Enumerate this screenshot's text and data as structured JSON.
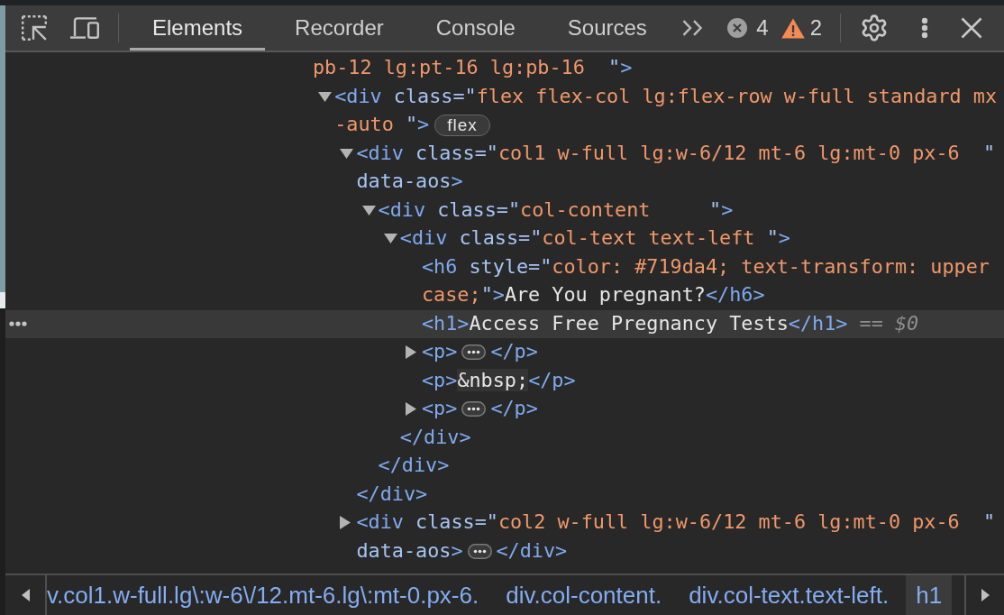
{
  "tabs": [
    {
      "label": "Elements",
      "selected": true
    },
    {
      "label": "Recorder",
      "selected": false
    },
    {
      "label": "Console",
      "selected": false
    },
    {
      "label": "Sources",
      "selected": false
    }
  ],
  "issue_counts": {
    "errors": "4",
    "warnings": "2"
  },
  "dom_tree": [
    {
      "selected": false,
      "lines": [
        [
          {
            "kind": "value",
            "text": "pb-12 lg:pt-16 lg:pb-16  "
          },
          {
            "kind": "attr",
            "text": "\""
          },
          {
            "kind": "tag",
            "text": ">"
          }
        ]
      ],
      "children": [
        {
          "expanded": true,
          "selected": false,
          "lines": [
            [
              {
                "kind": "tag",
                "text": "<div"
              },
              {
                "kind": "attr",
                "text": " class=\""
              },
              {
                "kind": "value",
                "text": "flex flex-col lg:flex-row w-full standard mx"
              }
            ],
            [
              {
                "kind": "value",
                "text": "-auto "
              },
              {
                "kind": "attr",
                "text": "\""
              },
              {
                "kind": "tag",
                "text": ">"
              },
              {
                "kind": "badge",
                "text": "flex"
              }
            ]
          ],
          "children": [
            {
              "expanded": true,
              "selected": false,
              "lines": [
                [
                  {
                    "kind": "tag",
                    "text": "<div"
                  },
                  {
                    "kind": "attr",
                    "text": " class=\""
                  },
                  {
                    "kind": "value",
                    "text": "col1 w-full lg:w-6/12 mt-6 lg:mt-0 px-6  "
                  },
                  {
                    "kind": "attr",
                    "text": "\""
                  }
                ],
                [
                  {
                    "kind": "attr",
                    "text": "data-aos"
                  },
                  {
                    "kind": "tag",
                    "text": ">"
                  }
                ]
              ],
              "children": [
                {
                  "expanded": true,
                  "selected": false,
                  "lines": [
                    [
                      {
                        "kind": "tag",
                        "text": "<div"
                      },
                      {
                        "kind": "attr",
                        "text": " class=\""
                      },
                      {
                        "kind": "value",
                        "text": "col-content     "
                      },
                      {
                        "kind": "attr",
                        "text": "\""
                      },
                      {
                        "kind": "tag",
                        "text": ">"
                      }
                    ]
                  ],
                  "children": [
                    {
                      "expanded": true,
                      "selected": false,
                      "lines": [
                        [
                          {
                            "kind": "tag",
                            "text": "<div"
                          },
                          {
                            "kind": "attr",
                            "text": " class=\""
                          },
                          {
                            "kind": "value",
                            "text": "col-text text-left "
                          },
                          {
                            "kind": "attr",
                            "text": "\""
                          },
                          {
                            "kind": "tag",
                            "text": ">"
                          }
                        ]
                      ],
                      "children": [
                        {
                          "selected": false,
                          "lines": [
                            [
                              {
                                "kind": "tag",
                                "text": "<h6"
                              },
                              {
                                "kind": "attr",
                                "text": " style=\""
                              },
                              {
                                "kind": "value",
                                "text": "color: #719da4; text-transform: upper"
                              }
                            ],
                            [
                              {
                                "kind": "value",
                                "text": "case;"
                              },
                              {
                                "kind": "attr",
                                "text": "\""
                              },
                              {
                                "kind": "tag",
                                "text": ">"
                              },
                              {
                                "kind": "text",
                                "text": "Are You pregnant?"
                              },
                              {
                                "kind": "tag",
                                "text": "</h6>"
                              }
                            ]
                          ]
                        },
                        {
                          "selected": true,
                          "lines": [
                            [
                              {
                                "kind": "tag",
                                "text": "<h1>"
                              },
                              {
                                "kind": "text",
                                "text": "Access Free Pregnancy Tests"
                              },
                              {
                                "kind": "tag",
                                "text": "</h1>"
                              },
                              {
                                "kind": "ref",
                                "text": " == *$0*"
                              }
                            ]
                          ]
                        },
                        {
                          "expanded": false,
                          "selected": false,
                          "lines": [
                            [
                              {
                                "kind": "tag",
                                "text": "<p>"
                              },
                              {
                                "kind": "ellipsis"
                              },
                              {
                                "kind": "tag",
                                "text": "</p>"
                              }
                            ]
                          ]
                        },
                        {
                          "selected": false,
                          "lines": [
                            [
                              {
                                "kind": "tag",
                                "text": "<p>"
                              },
                              {
                                "kind": "entity",
                                "text": "&nbsp;"
                              },
                              {
                                "kind": "tag",
                                "text": "</p>"
                              }
                            ]
                          ]
                        },
                        {
                          "expanded": false,
                          "selected": false,
                          "lines": [
                            [
                              {
                                "kind": "tag",
                                "text": "<p>"
                              },
                              {
                                "kind": "ellipsis"
                              },
                              {
                                "kind": "tag",
                                "text": "</p>"
                              }
                            ]
                          ]
                        }
                      ],
                      "closing": [
                        {
                          "kind": "tag",
                          "text": "</div>"
                        }
                      ]
                    }
                  ],
                  "closing": [
                    {
                      "kind": "tag",
                      "text": "</div>"
                    }
                  ]
                }
              ],
              "closing": [
                {
                  "kind": "tag",
                  "text": "</div>"
                }
              ]
            },
            {
              "expanded": false,
              "selected": false,
              "lines": [
                [
                  {
                    "kind": "tag",
                    "text": "<div"
                  },
                  {
                    "kind": "attr",
                    "text": " class=\""
                  },
                  {
                    "kind": "value",
                    "text": "col2 w-full lg:w-6/12 mt-6 lg:mt-0 px-6  "
                  },
                  {
                    "kind": "attr",
                    "text": "\""
                  }
                ],
                [
                  {
                    "kind": "attr",
                    "text": "data-aos"
                  },
                  {
                    "kind": "tag",
                    "text": ">"
                  },
                  {
                    "kind": "ellipsis"
                  },
                  {
                    "kind": "tag",
                    "text": "</div>"
                  }
                ]
              ]
            }
          ]
        }
      ]
    }
  ],
  "breadcrumbs": [
    {
      "label": "v.col1.w-full.lg\\:w-6\\/12.mt-6.lg\\:mt-0.px-6.",
      "selected": false
    },
    {
      "label": "div.col-content.",
      "selected": false
    },
    {
      "label": "div.col-text.text-left.",
      "selected": false
    },
    {
      "label": "h1",
      "selected": true
    }
  ]
}
